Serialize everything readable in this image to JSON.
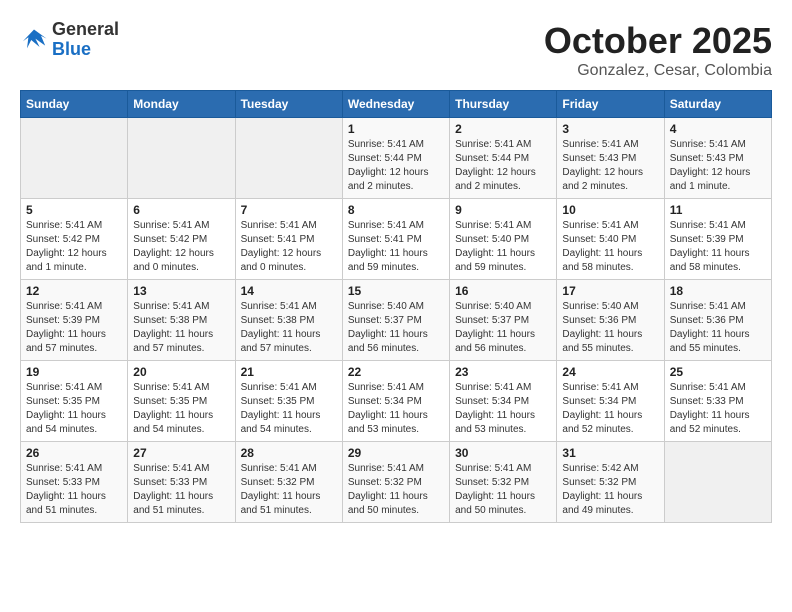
{
  "header": {
    "logo_line1": "General",
    "logo_line2": "Blue",
    "month_title": "October 2025",
    "location": "Gonzalez, Cesar, Colombia"
  },
  "days_of_week": [
    "Sunday",
    "Monday",
    "Tuesday",
    "Wednesday",
    "Thursday",
    "Friday",
    "Saturday"
  ],
  "weeks": [
    [
      {
        "day": "",
        "info": ""
      },
      {
        "day": "",
        "info": ""
      },
      {
        "day": "",
        "info": ""
      },
      {
        "day": "1",
        "info": "Sunrise: 5:41 AM\nSunset: 5:44 PM\nDaylight: 12 hours and 2 minutes."
      },
      {
        "day": "2",
        "info": "Sunrise: 5:41 AM\nSunset: 5:44 PM\nDaylight: 12 hours and 2 minutes."
      },
      {
        "day": "3",
        "info": "Sunrise: 5:41 AM\nSunset: 5:43 PM\nDaylight: 12 hours and 2 minutes."
      },
      {
        "day": "4",
        "info": "Sunrise: 5:41 AM\nSunset: 5:43 PM\nDaylight: 12 hours and 1 minute."
      }
    ],
    [
      {
        "day": "5",
        "info": "Sunrise: 5:41 AM\nSunset: 5:42 PM\nDaylight: 12 hours and 1 minute."
      },
      {
        "day": "6",
        "info": "Sunrise: 5:41 AM\nSunset: 5:42 PM\nDaylight: 12 hours and 0 minutes."
      },
      {
        "day": "7",
        "info": "Sunrise: 5:41 AM\nSunset: 5:41 PM\nDaylight: 12 hours and 0 minutes."
      },
      {
        "day": "8",
        "info": "Sunrise: 5:41 AM\nSunset: 5:41 PM\nDaylight: 11 hours and 59 minutes."
      },
      {
        "day": "9",
        "info": "Sunrise: 5:41 AM\nSunset: 5:40 PM\nDaylight: 11 hours and 59 minutes."
      },
      {
        "day": "10",
        "info": "Sunrise: 5:41 AM\nSunset: 5:40 PM\nDaylight: 11 hours and 58 minutes."
      },
      {
        "day": "11",
        "info": "Sunrise: 5:41 AM\nSunset: 5:39 PM\nDaylight: 11 hours and 58 minutes."
      }
    ],
    [
      {
        "day": "12",
        "info": "Sunrise: 5:41 AM\nSunset: 5:39 PM\nDaylight: 11 hours and 57 minutes."
      },
      {
        "day": "13",
        "info": "Sunrise: 5:41 AM\nSunset: 5:38 PM\nDaylight: 11 hours and 57 minutes."
      },
      {
        "day": "14",
        "info": "Sunrise: 5:41 AM\nSunset: 5:38 PM\nDaylight: 11 hours and 57 minutes."
      },
      {
        "day": "15",
        "info": "Sunrise: 5:40 AM\nSunset: 5:37 PM\nDaylight: 11 hours and 56 minutes."
      },
      {
        "day": "16",
        "info": "Sunrise: 5:40 AM\nSunset: 5:37 PM\nDaylight: 11 hours and 56 minutes."
      },
      {
        "day": "17",
        "info": "Sunrise: 5:40 AM\nSunset: 5:36 PM\nDaylight: 11 hours and 55 minutes."
      },
      {
        "day": "18",
        "info": "Sunrise: 5:41 AM\nSunset: 5:36 PM\nDaylight: 11 hours and 55 minutes."
      }
    ],
    [
      {
        "day": "19",
        "info": "Sunrise: 5:41 AM\nSunset: 5:35 PM\nDaylight: 11 hours and 54 minutes."
      },
      {
        "day": "20",
        "info": "Sunrise: 5:41 AM\nSunset: 5:35 PM\nDaylight: 11 hours and 54 minutes."
      },
      {
        "day": "21",
        "info": "Sunrise: 5:41 AM\nSunset: 5:35 PM\nDaylight: 11 hours and 54 minutes."
      },
      {
        "day": "22",
        "info": "Sunrise: 5:41 AM\nSunset: 5:34 PM\nDaylight: 11 hours and 53 minutes."
      },
      {
        "day": "23",
        "info": "Sunrise: 5:41 AM\nSunset: 5:34 PM\nDaylight: 11 hours and 53 minutes."
      },
      {
        "day": "24",
        "info": "Sunrise: 5:41 AM\nSunset: 5:34 PM\nDaylight: 11 hours and 52 minutes."
      },
      {
        "day": "25",
        "info": "Sunrise: 5:41 AM\nSunset: 5:33 PM\nDaylight: 11 hours and 52 minutes."
      }
    ],
    [
      {
        "day": "26",
        "info": "Sunrise: 5:41 AM\nSunset: 5:33 PM\nDaylight: 11 hours and 51 minutes."
      },
      {
        "day": "27",
        "info": "Sunrise: 5:41 AM\nSunset: 5:33 PM\nDaylight: 11 hours and 51 minutes."
      },
      {
        "day": "28",
        "info": "Sunrise: 5:41 AM\nSunset: 5:32 PM\nDaylight: 11 hours and 51 minutes."
      },
      {
        "day": "29",
        "info": "Sunrise: 5:41 AM\nSunset: 5:32 PM\nDaylight: 11 hours and 50 minutes."
      },
      {
        "day": "30",
        "info": "Sunrise: 5:41 AM\nSunset: 5:32 PM\nDaylight: 11 hours and 50 minutes."
      },
      {
        "day": "31",
        "info": "Sunrise: 5:42 AM\nSunset: 5:32 PM\nDaylight: 11 hours and 49 minutes."
      },
      {
        "day": "",
        "info": ""
      }
    ]
  ]
}
